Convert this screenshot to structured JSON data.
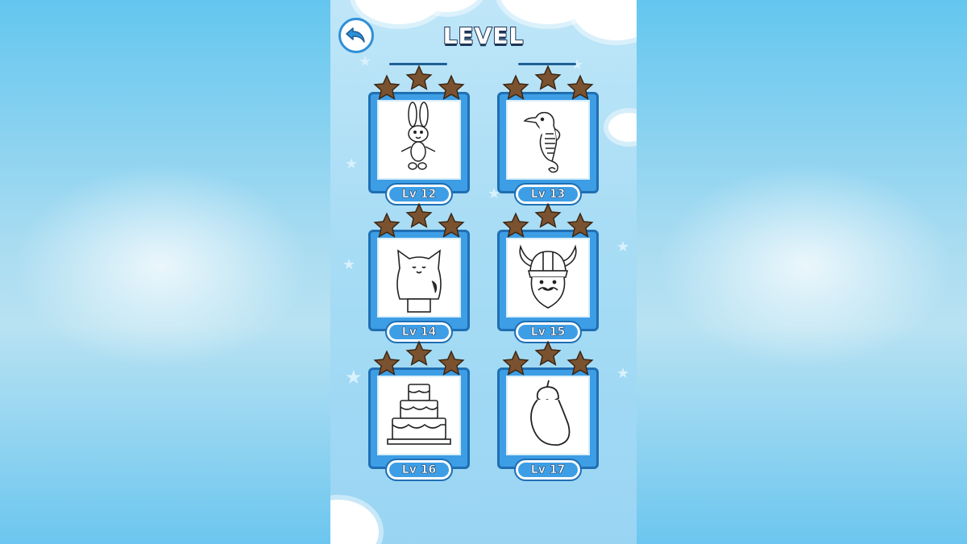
{
  "screen": {
    "title": "LEVEL",
    "back_icon": "back-arrow-icon"
  },
  "colors": {
    "star": "#7a5230",
    "frame": "#3d9ee6",
    "frame_border": "#1f6fb3",
    "background": "#a9ddf5"
  },
  "levels": [
    {
      "label": "Lv 12",
      "picture": "bunny-icon",
      "stars": 3
    },
    {
      "label": "Lv 13",
      "picture": "seahorse-icon",
      "stars": 3
    },
    {
      "label": "Lv 14",
      "picture": "cat-icon",
      "stars": 3
    },
    {
      "label": "Lv 15",
      "picture": "viking-icon",
      "stars": 3
    },
    {
      "label": "Lv 16",
      "picture": "cake-icon",
      "stars": 3
    },
    {
      "label": "Lv 17",
      "picture": "eggplant-icon",
      "stars": 3
    }
  ]
}
